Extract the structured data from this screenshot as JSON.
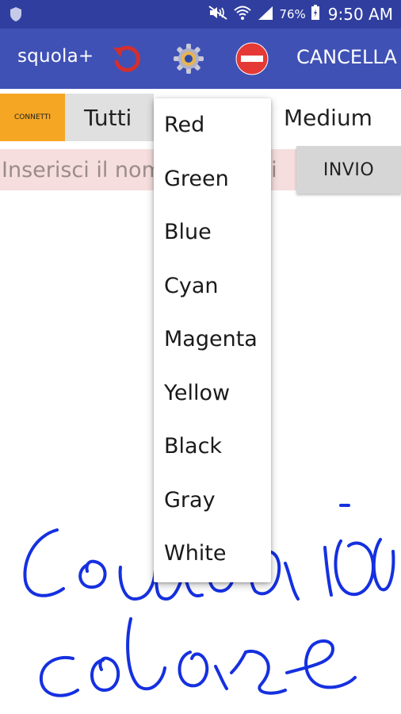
{
  "status_bar": {
    "battery_percent": "76%",
    "time": "9:50 AM",
    "icons": [
      "shield-icon",
      "mute-icon",
      "wifi-icon",
      "signal-icon",
      "battery-icon"
    ]
  },
  "app_bar": {
    "title": "squola+",
    "cancel_label": "CANCELLA",
    "icons": [
      "undo-icon",
      "gear-icon",
      "stop-icon"
    ],
    "colors": {
      "primary": "#3f51b5",
      "primary_dark": "#303f9f"
    }
  },
  "options": {
    "connect_label": "CONNETTI",
    "recipients_value": "Tutti",
    "size_value": "Medium",
    "connect_color": "#f5a623"
  },
  "message": {
    "placeholder": "Inserisci il nome o ?? vedi",
    "send_label": "INVIO"
  },
  "color_menu": {
    "items": [
      "Red",
      "Green",
      "Blue",
      "Cyan",
      "Magenta",
      "Yellow",
      "Black",
      "Gray",
      "White"
    ]
  },
  "canvas": {
    "ink_color": "#1530e0"
  }
}
